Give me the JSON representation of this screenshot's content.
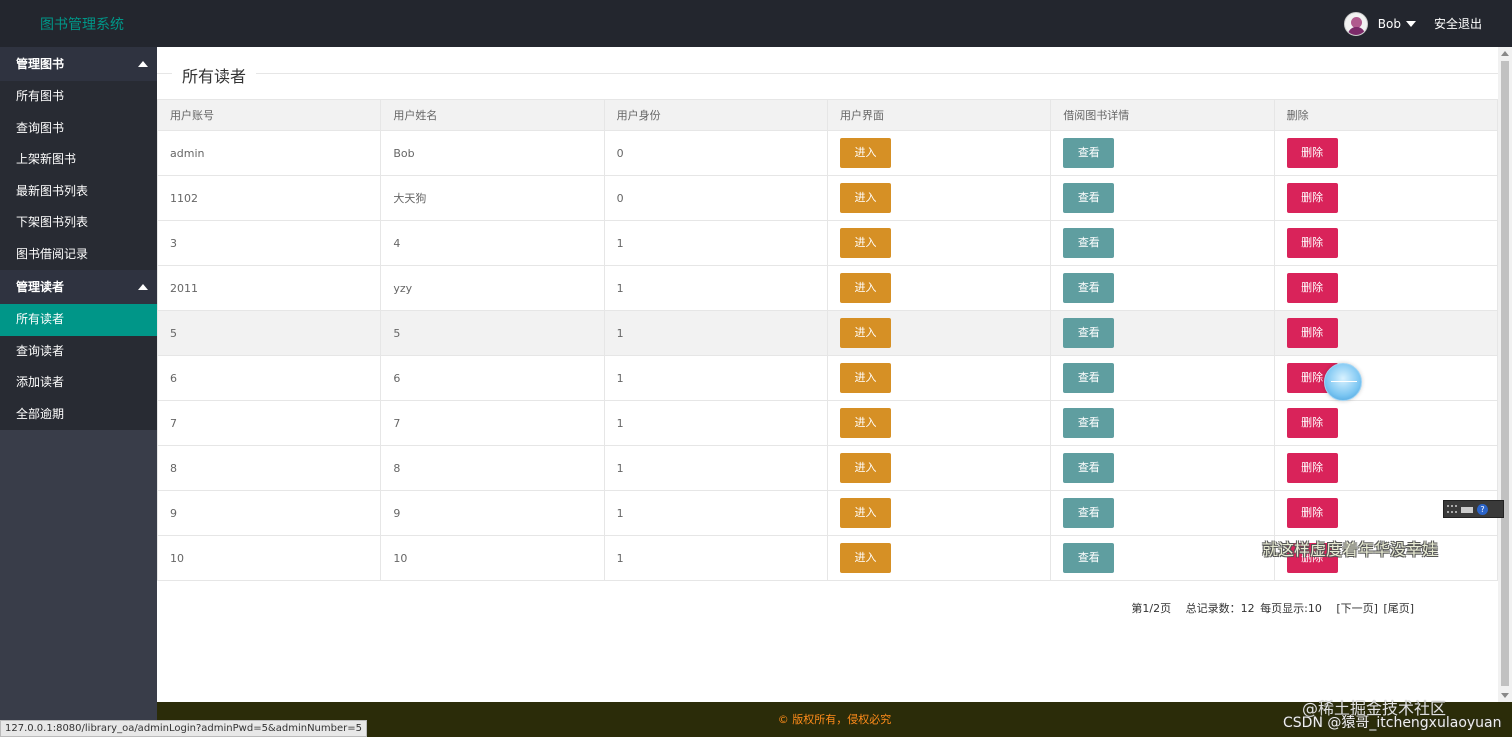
{
  "header": {
    "logo": "图书管理系统",
    "user_name": "Bob",
    "logout": "安全退出"
  },
  "sidebar": {
    "groups": [
      {
        "title": "管理图书",
        "items": [
          "所有图书",
          "查询图书",
          "上架新图书",
          "最新图书列表",
          "下架图书列表",
          "图书借阅记录"
        ]
      },
      {
        "title": "管理读者",
        "items": [
          "所有读者",
          "查询读者",
          "添加读者",
          "全部逾期"
        ]
      }
    ],
    "active_item": "所有读者"
  },
  "main": {
    "title": "所有读者",
    "columns": [
      "用户账号",
      "用户姓名",
      "用户身份",
      "用户界面",
      "借阅图书详情",
      "删除"
    ],
    "rows": [
      {
        "account": "admin",
        "name": "Bob",
        "role": "0"
      },
      {
        "account": "1102",
        "name": "大天狗",
        "role": "0"
      },
      {
        "account": "3",
        "name": "4",
        "role": "1"
      },
      {
        "account": "2011",
        "name": "yzy",
        "role": "1"
      },
      {
        "account": "5",
        "name": "5",
        "role": "1"
      },
      {
        "account": "6",
        "name": "6",
        "role": "1"
      },
      {
        "account": "7",
        "name": "7",
        "role": "1"
      },
      {
        "account": "8",
        "name": "8",
        "role": "1"
      },
      {
        "account": "9",
        "name": "9",
        "role": "1"
      },
      {
        "account": "10",
        "name": "10",
        "role": "1"
      }
    ],
    "buttons": {
      "enter": "进入",
      "view": "查看",
      "delete": "删除"
    },
    "pager": {
      "page": "第1/2页",
      "total": "总记录数：12",
      "per_page": "每页显示:10",
      "next": "[下一页]",
      "last": "[尾页]"
    }
  },
  "footer": {
    "copyright": "© 版权所有，侵权必究"
  },
  "status_bar": {
    "url": "127.0.0.1:8080/library_oa/adminLogin?adminPwd=5&adminNumber=5"
  },
  "overlays": {
    "lyric": "就这样虚度着年华没幸娃",
    "watermark_1": "@稀土掘金技术社区",
    "watermark_2": "CSDN @猿哥_itchengxulaoyuan",
    "ime_help": "?"
  },
  "colors": {
    "header_bg": "#23262e",
    "logo": "#009688",
    "sidebar_bg": "#393d49",
    "sidebar_active": "#009688",
    "btn_enter": "#d69025",
    "btn_view": "#5f9ea0",
    "btn_delete": "#d9235a",
    "footer_bg": "#2b2c09",
    "footer_text": "#ff8c1a"
  }
}
